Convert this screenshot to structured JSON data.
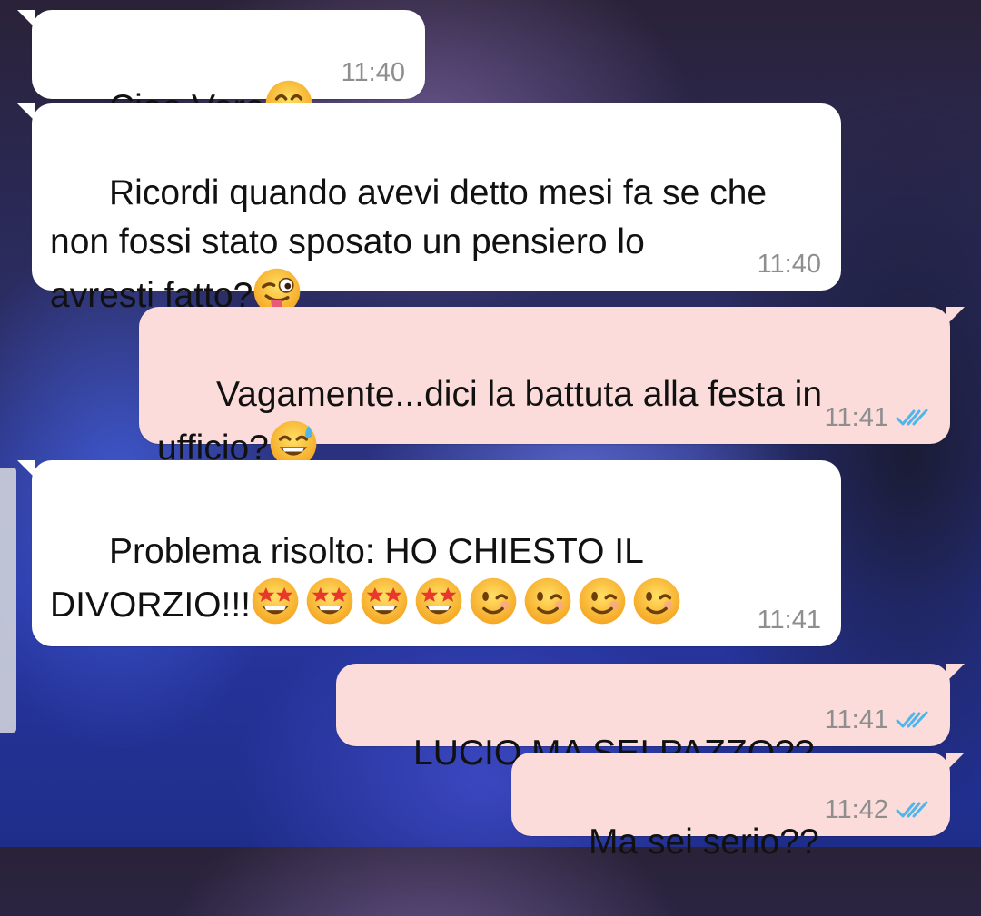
{
  "messages": [
    {
      "direction": "in",
      "text": "Ciao Vero",
      "time": "11:40"
    },
    {
      "direction": "in",
      "text": "Ricordi quando avevi detto mesi fa se che\nnon fossi stato sposato un pensiero lo\navresti fatto?",
      "time": "11:40"
    },
    {
      "direction": "out",
      "text": "Vagamente...dici la battuta alla festa in\nufficio?",
      "time": "11:41",
      "status": "read"
    },
    {
      "direction": "in",
      "text_line1": "Problema risolto: HO CHIESTO IL",
      "text_line2": "DIVORZIO!!!",
      "time": "11:41"
    },
    {
      "direction": "out",
      "text": "LUCIO MA SEI PAZZO??",
      "time": "11:41",
      "status": "read"
    },
    {
      "direction": "out",
      "text": "Ma sei serio??",
      "time": "11:42",
      "status": "read"
    }
  ],
  "emojis": {
    "m1": [
      "smiling-face-icon"
    ],
    "m2": [
      "winking-tongue-face-icon"
    ],
    "m3": [
      "grinning-sweat-face-icon"
    ],
    "m4": [
      "star-struck-icon",
      "star-struck-icon",
      "star-struck-icon",
      "star-struck-icon",
      "winking-face-icon",
      "winking-face-icon",
      "winking-face-icon",
      "winking-face-icon"
    ]
  },
  "colors": {
    "incoming_bubble": "#ffffff",
    "outgoing_bubble": "#fcdcdb",
    "timestamp": "#8e8e8e",
    "read_check": "#4fb6ec"
  }
}
